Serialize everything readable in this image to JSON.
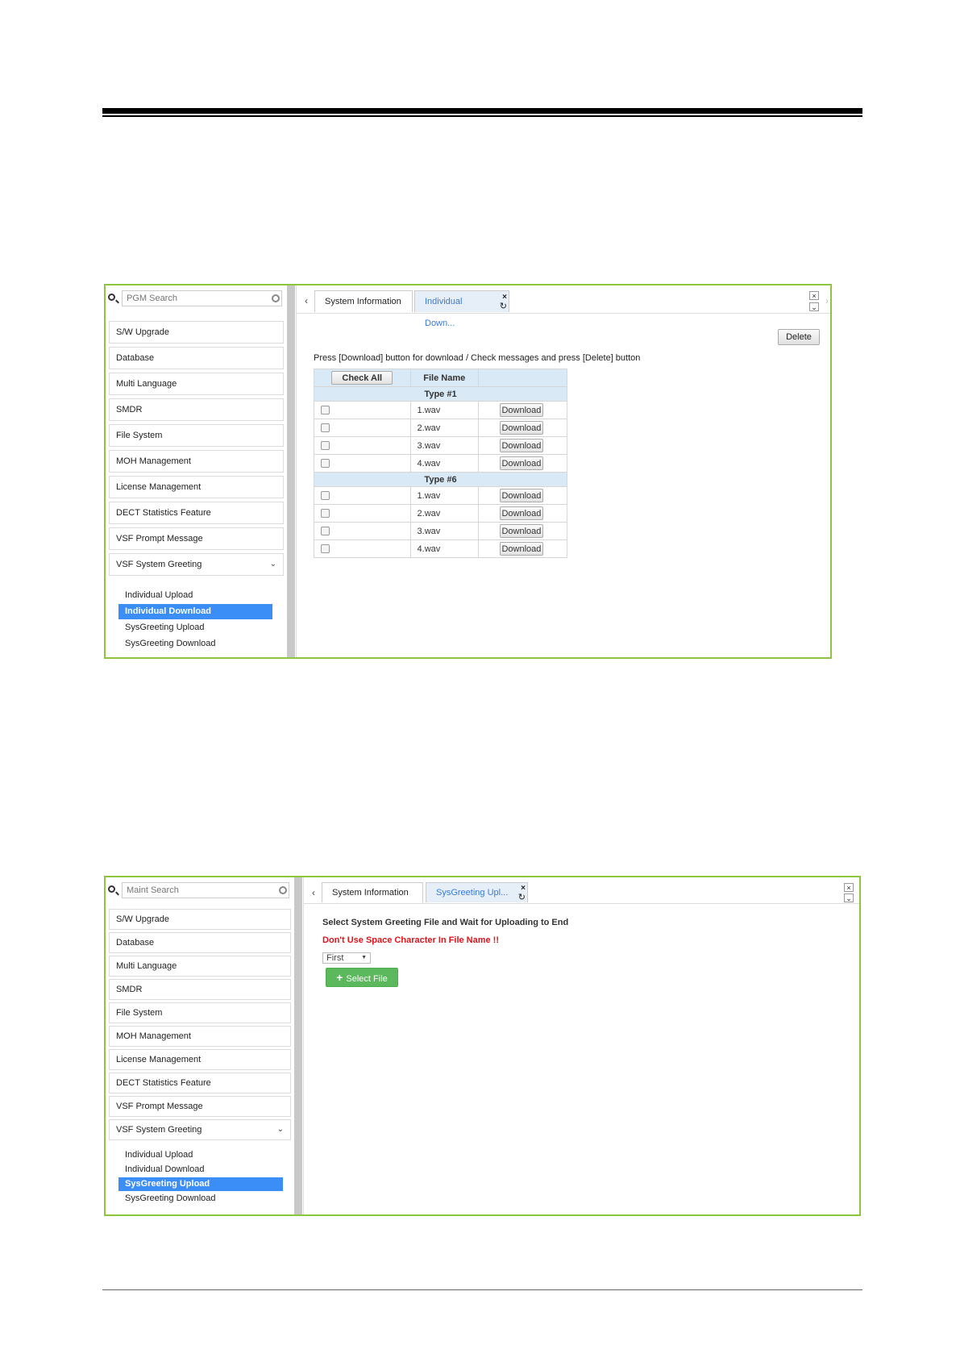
{
  "screenshot1": {
    "search_placeholder": "PGM Search",
    "menu": [
      "S/W Upgrade",
      "Database",
      "Multi Language",
      "SMDR",
      "File System",
      "MOH Management",
      "License Management",
      "DECT Statistics Feature",
      "VSF Prompt Message",
      "VSF System Greeting"
    ],
    "submenu": [
      "Individual Upload",
      "Individual Download",
      "SysGreeting Upload",
      "SysGreeting Download"
    ],
    "tabs": {
      "tab1": "System Information",
      "tab2": "Individual Down..."
    },
    "delete_label": "Delete",
    "instruction": "Press [Download] button for download / Check messages and press [Delete] button",
    "table": {
      "check_all": "Check All",
      "file_name_header": "File Name",
      "groups": [
        {
          "type": "Type #1",
          "files": [
            "1.wav",
            "2.wav",
            "3.wav",
            "4.wav"
          ]
        },
        {
          "type": "Type #6",
          "files": [
            "1.wav",
            "2.wav",
            "3.wav",
            "4.wav"
          ]
        }
      ],
      "download_label": "Download"
    }
  },
  "screenshot2": {
    "search_placeholder": "Maint Search",
    "menu": [
      "S/W Upgrade",
      "Database",
      "Multi Language",
      "SMDR",
      "File System",
      "MOH Management",
      "License Management",
      "DECT Statistics Feature",
      "VSF Prompt Message",
      "VSF System Greeting"
    ],
    "submenu": [
      "Individual Upload",
      "Individual Download",
      "SysGreeting Upload",
      "SysGreeting Download"
    ],
    "tabs": {
      "tab1": "System Information",
      "tab2": "SysGreeting Upl..."
    },
    "title": "Select System Greeting File and Wait for Uploading to End",
    "warning": "Don't Use Space Character In File Name !!",
    "select_value": "First",
    "select_file_label": "Select File"
  },
  "colors": {
    "accent_green": "#8cc63f",
    "active_blue": "#3a8ef6",
    "warning_red": "#e0131a",
    "button_green": "#5cb85c"
  }
}
